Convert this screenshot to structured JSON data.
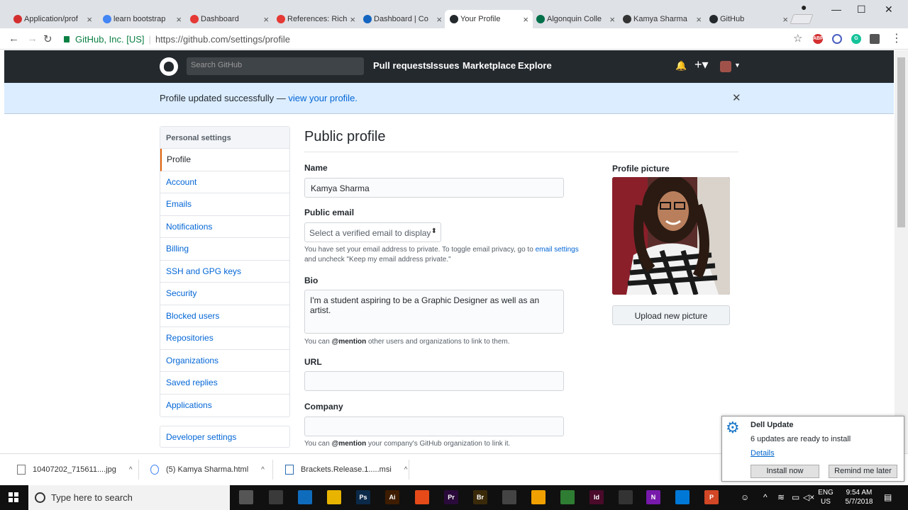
{
  "browser": {
    "tabs": [
      {
        "title": "Application/prof",
        "icon": "maple-leaf-icon",
        "color": "#d32f2f"
      },
      {
        "title": "learn bootstrap",
        "icon": "google-icon",
        "color": "#4285f4"
      },
      {
        "title": "Dashboard",
        "icon": "lifebuoy-icon",
        "color": "#e53935"
      },
      {
        "title": "References: Rich",
        "icon": "lifebuoy-icon",
        "color": "#e53935"
      },
      {
        "title": "Dashboard | Co",
        "icon": "code-icon",
        "color": "#1565c0"
      },
      {
        "title": "Your Profile",
        "icon": "github-icon",
        "color": "#24292e"
      },
      {
        "title": "Algonquin Colle",
        "icon": "algonquin-icon",
        "color": "#00704a"
      },
      {
        "title": "Kamya Sharma",
        "icon": "codepen-icon",
        "color": "#333333"
      },
      {
        "title": "GitHub",
        "icon": "github-icon",
        "color": "#24292e"
      }
    ],
    "site_identity": "GitHub, Inc. [US]",
    "url": "https://github.com/settings/profile",
    "extensions": [
      "ABP",
      "block",
      "G",
      "eraser"
    ]
  },
  "header": {
    "search_placeholder": "Search GitHub",
    "nav": [
      "Pull requests",
      "Issues",
      "Marketplace",
      "Explore"
    ]
  },
  "flash": {
    "text": "Profile updated successfully — ",
    "link": "view your profile."
  },
  "sidebar": {
    "heading": "Personal settings",
    "items": [
      "Profile",
      "Account",
      "Emails",
      "Notifications",
      "Billing",
      "SSH and GPG keys",
      "Security",
      "Blocked users",
      "Repositories",
      "Organizations",
      "Saved replies",
      "Applications"
    ],
    "developer": "Developer settings"
  },
  "profile": {
    "title": "Public profile",
    "name_label": "Name",
    "name_value": "Kamya Sharma",
    "email_label": "Public email",
    "email_select": "Select a verified email to display",
    "email_note_1": "You have set your email address to private. To toggle email privacy, go to ",
    "email_note_link": "email settings",
    "email_note_2": "and uncheck \"Keep my email address private.\"",
    "bio_label": "Bio",
    "bio_value": "I'm a student aspiring to be a Graphic Designer as well as an artist.",
    "bio_note_pre": "You can ",
    "bio_note_bold": "@mention",
    "bio_note_post": " other users and organizations to link to them.",
    "url_label": "URL",
    "url_value": "",
    "company_label": "Company",
    "company_value": "",
    "company_note_pre": "You can ",
    "company_note_bold": "@mention",
    "company_note_post": " your company's GitHub organization to link it.",
    "picture_label": "Profile picture",
    "upload_label": "Upload new picture"
  },
  "downloads": [
    {
      "name": "10407202_715611....jpg"
    },
    {
      "name": "(5) Kamya Sharma.html"
    },
    {
      "name": "Brackets.Release.1.....msi"
    }
  ],
  "toast": {
    "title": "Dell Update",
    "body": "6 updates are ready to install",
    "link": "Details",
    "install": "Install now",
    "remind": "Remind me later"
  },
  "taskbar": {
    "search_placeholder": "Type here to search",
    "apps": [
      {
        "label": "",
        "color": "#555"
      },
      {
        "label": "",
        "color": "#3a3a3a"
      },
      {
        "label": "",
        "color": "#0f6cbd"
      },
      {
        "label": "",
        "color": "#e8b400"
      },
      {
        "label": "Ps",
        "color": "#0b2a4a"
      },
      {
        "label": "Ai",
        "color": "#3d1c00"
      },
      {
        "label": "",
        "color": "#e64a19"
      },
      {
        "label": "Pr",
        "color": "#2a0a3a"
      },
      {
        "label": "Br",
        "color": "#3a2a0a"
      },
      {
        "label": "",
        "color": "#444"
      },
      {
        "label": "",
        "color": "#f0a000"
      },
      {
        "label": "",
        "color": "#2e7d32"
      },
      {
        "label": "Id",
        "color": "#4a0a2a"
      },
      {
        "label": "",
        "color": "#333"
      },
      {
        "label": "N",
        "color": "#7719aa"
      },
      {
        "label": "",
        "color": "#0078d7"
      },
      {
        "label": "P",
        "color": "#d24726"
      }
    ],
    "lang_1": "ENG",
    "lang_2": "US",
    "time": "9:54 AM",
    "date": "5/7/2018"
  }
}
